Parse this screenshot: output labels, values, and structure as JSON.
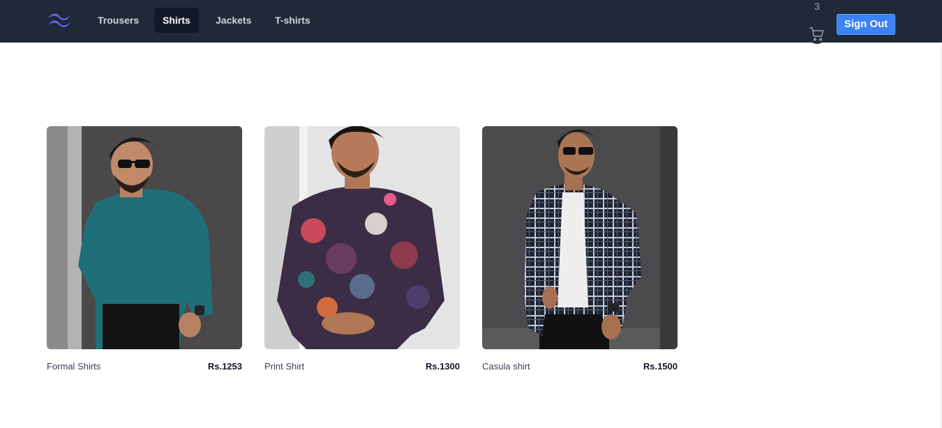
{
  "nav": {
    "logo_icon": "tailwind-wave-logo",
    "items": [
      {
        "label": "Trousers",
        "active": false
      },
      {
        "label": "Shirts",
        "active": true
      },
      {
        "label": "Jackets",
        "active": false
      },
      {
        "label": "T-shirts",
        "active": false
      }
    ],
    "cart_count": "3",
    "cart_icon": "shopping-cart-icon",
    "signout_label": "Sign Out"
  },
  "colors": {
    "navbar": "#1f2937",
    "active_tab": "#111827",
    "signout": "#3b82f6",
    "logo": "#6366f1"
  },
  "products": [
    {
      "name": "Formal Shirts",
      "price": "Rs.1253"
    },
    {
      "name": "Print Shirt",
      "price": "Rs.1300"
    },
    {
      "name": "Casula shirt",
      "price": "Rs.1500"
    }
  ]
}
